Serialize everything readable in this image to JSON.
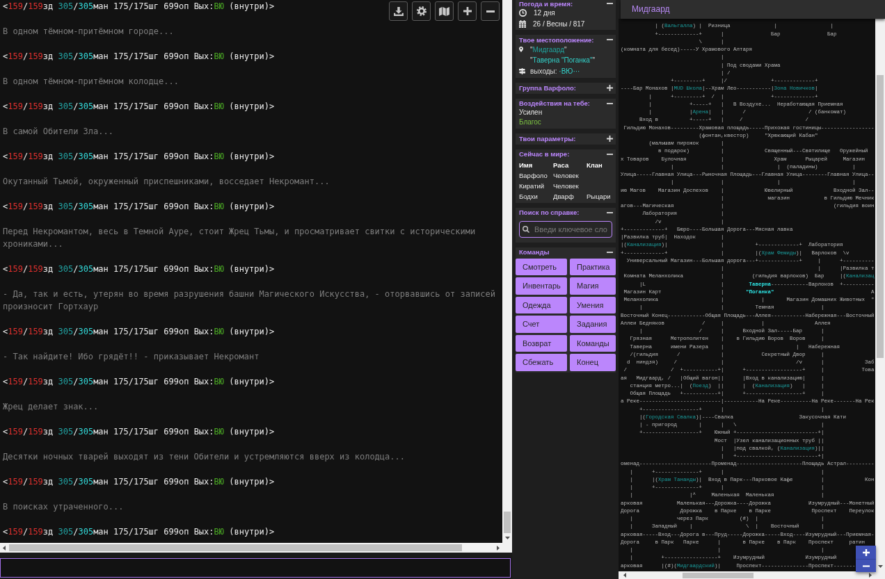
{
  "terminal": {
    "log": [
      {
        "kind": "prompt",
        "parts": [
          {
            "text": "<",
            "kind": "plain"
          },
          {
            "text": "159",
            "kind": "hp"
          },
          {
            "text": "/",
            "kind": "plain"
          },
          {
            "text": "159",
            "kind": "hp"
          },
          {
            "text": "зд ",
            "kind": "plain"
          },
          {
            "text": "305",
            "kind": "mana"
          },
          {
            "text": "/",
            "kind": "plain"
          },
          {
            "text": "305",
            "kind": "mana_max"
          },
          {
            "text": "ман 175/175шг 699оп Вых:",
            "kind": "plain"
          },
          {
            "text": "ВЮ",
            "kind": "exits"
          },
          {
            "text": " (внутри)>",
            "kind": "plain"
          }
        ]
      },
      {
        "kind": "message",
        "text": "В одном тёмном-притёмном городе..."
      },
      {
        "kind": "prompt",
        "parts": [
          {
            "text": "<",
            "kind": "plain"
          },
          {
            "text": "159",
            "kind": "hp"
          },
          {
            "text": "/",
            "kind": "plain"
          },
          {
            "text": "159",
            "kind": "hp"
          },
          {
            "text": "зд ",
            "kind": "plain"
          },
          {
            "text": "305",
            "kind": "mana"
          },
          {
            "text": "/",
            "kind": "plain"
          },
          {
            "text": "305",
            "kind": "mana_max"
          },
          {
            "text": "ман 175/175шг 699оп Вых:",
            "kind": "plain"
          },
          {
            "text": "ВЮ",
            "kind": "exits"
          },
          {
            "text": " (внутри)>",
            "kind": "plain"
          }
        ]
      },
      {
        "kind": "message",
        "text": "В одном тёмном-притёмном колодце..."
      },
      {
        "kind": "prompt",
        "parts": [
          {
            "text": "<",
            "kind": "plain"
          },
          {
            "text": "159",
            "kind": "hp"
          },
          {
            "text": "/",
            "kind": "plain"
          },
          {
            "text": "159",
            "kind": "hp"
          },
          {
            "text": "зд ",
            "kind": "plain"
          },
          {
            "text": "305",
            "kind": "mana"
          },
          {
            "text": "/",
            "kind": "plain"
          },
          {
            "text": "305",
            "kind": "mana_max"
          },
          {
            "text": "ман 175/175шг 699оп Вых:",
            "kind": "plain"
          },
          {
            "text": "ВЮ",
            "kind": "exits"
          },
          {
            "text": " (внутри)>",
            "kind": "plain"
          }
        ]
      },
      {
        "kind": "message",
        "text": "В самой Обители Зла..."
      },
      {
        "kind": "prompt",
        "parts": [
          {
            "text": "<",
            "kind": "plain"
          },
          {
            "text": "159",
            "kind": "hp"
          },
          {
            "text": "/",
            "kind": "plain"
          },
          {
            "text": "159",
            "kind": "hp"
          },
          {
            "text": "зд ",
            "kind": "plain"
          },
          {
            "text": "305",
            "kind": "mana"
          },
          {
            "text": "/",
            "kind": "plain"
          },
          {
            "text": "305",
            "kind": "mana_max"
          },
          {
            "text": "ман 175/175шг 699оп Вых:",
            "kind": "plain"
          },
          {
            "text": "ВЮ",
            "kind": "exits"
          },
          {
            "text": " (внутри)>",
            "kind": "plain"
          }
        ]
      },
      {
        "kind": "message",
        "text": "Окутанный Тьмой, окруженный приспешниками, восседает Некромант..."
      },
      {
        "kind": "prompt",
        "parts": [
          {
            "text": "<",
            "kind": "plain"
          },
          {
            "text": "159",
            "kind": "hp"
          },
          {
            "text": "/",
            "kind": "plain"
          },
          {
            "text": "159",
            "kind": "hp"
          },
          {
            "text": "зд ",
            "kind": "plain"
          },
          {
            "text": "305",
            "kind": "mana"
          },
          {
            "text": "/",
            "kind": "plain"
          },
          {
            "text": "305",
            "kind": "mana_max"
          },
          {
            "text": "ман 175/175шг 699оп Вых:",
            "kind": "plain"
          },
          {
            "text": "ВЮ",
            "kind": "exits"
          },
          {
            "text": " (внутри)>",
            "kind": "plain"
          }
        ]
      },
      {
        "kind": "message",
        "text": "Перед Некромантом, весь в Темной Ауре, стоит Жрец Тьмы, и просматривает свитки с историческими хрониками..."
      },
      {
        "kind": "prompt",
        "parts": [
          {
            "text": "<",
            "kind": "plain"
          },
          {
            "text": "159",
            "kind": "hp"
          },
          {
            "text": "/",
            "kind": "plain"
          },
          {
            "text": "159",
            "kind": "hp"
          },
          {
            "text": "зд ",
            "kind": "plain"
          },
          {
            "text": "305",
            "kind": "mana"
          },
          {
            "text": "/",
            "kind": "plain"
          },
          {
            "text": "305",
            "kind": "mana_max"
          },
          {
            "text": "ман 175/175шг 699оп Вых:",
            "kind": "plain"
          },
          {
            "text": "ВЮ",
            "kind": "exits"
          },
          {
            "text": " (внутри)>",
            "kind": "plain"
          }
        ]
      },
      {
        "kind": "message",
        "text": "- Да, так и есть, утерян во время разрушения башни Магического Искусства, - оторвавшись от записей произносит Гортхаур"
      },
      {
        "kind": "prompt",
        "parts": [
          {
            "text": "<",
            "kind": "plain"
          },
          {
            "text": "159",
            "kind": "hp"
          },
          {
            "text": "/",
            "kind": "plain"
          },
          {
            "text": "159",
            "kind": "hp"
          },
          {
            "text": "зд ",
            "kind": "plain"
          },
          {
            "text": "305",
            "kind": "mana"
          },
          {
            "text": "/",
            "kind": "plain"
          },
          {
            "text": "305",
            "kind": "mana_max"
          },
          {
            "text": "ман 175/175шг 699оп Вых:",
            "kind": "plain"
          },
          {
            "text": "ВЮ",
            "kind": "exits"
          },
          {
            "text": " (внутри)>",
            "kind": "plain"
          }
        ]
      },
      {
        "kind": "message",
        "text": "- Так найдите! Ибо грядёт!! - приказывает Некромант"
      },
      {
        "kind": "prompt",
        "parts": [
          {
            "text": "<",
            "kind": "plain"
          },
          {
            "text": "159",
            "kind": "hp"
          },
          {
            "text": "/",
            "kind": "plain"
          },
          {
            "text": "159",
            "kind": "hp"
          },
          {
            "text": "зд ",
            "kind": "plain"
          },
          {
            "text": "305",
            "kind": "mana"
          },
          {
            "text": "/",
            "kind": "plain"
          },
          {
            "text": "305",
            "kind": "mana_max"
          },
          {
            "text": "ман 175/175шг 699оп Вых:",
            "kind": "plain"
          },
          {
            "text": "ВЮ",
            "kind": "exits"
          },
          {
            "text": " (внутри)>",
            "kind": "plain"
          }
        ]
      },
      {
        "kind": "message",
        "text": "Жрец делает знак..."
      },
      {
        "kind": "prompt",
        "parts": [
          {
            "text": "<",
            "kind": "plain"
          },
          {
            "text": "159",
            "kind": "hp"
          },
          {
            "text": "/",
            "kind": "plain"
          },
          {
            "text": "159",
            "kind": "hp"
          },
          {
            "text": "зд ",
            "kind": "plain"
          },
          {
            "text": "305",
            "kind": "mana"
          },
          {
            "text": "/",
            "kind": "plain"
          },
          {
            "text": "305",
            "kind": "mana_max"
          },
          {
            "text": "ман 175/175шг 699оп Вых:",
            "kind": "plain"
          },
          {
            "text": "ВЮ",
            "kind": "exits"
          },
          {
            "text": " (внутри)>",
            "kind": "plain"
          }
        ]
      },
      {
        "kind": "message",
        "text": "Десятки ночных тварей выходят из тени Обители и устремляются вверх из колодца..."
      },
      {
        "kind": "prompt",
        "parts": [
          {
            "text": "<",
            "kind": "plain"
          },
          {
            "text": "159",
            "kind": "hp"
          },
          {
            "text": "/",
            "kind": "plain"
          },
          {
            "text": "159",
            "kind": "hp"
          },
          {
            "text": "зд ",
            "kind": "plain"
          },
          {
            "text": "305",
            "kind": "mana"
          },
          {
            "text": "/",
            "kind": "plain"
          },
          {
            "text": "305",
            "kind": "mana_max"
          },
          {
            "text": "ман 175/175шг 699оп Вых:",
            "kind": "plain"
          },
          {
            "text": "ВЮ",
            "kind": "exits"
          },
          {
            "text": " (внутри)>",
            "kind": "plain"
          }
        ]
      },
      {
        "kind": "message",
        "text": "В поисках утраченного..."
      },
      {
        "kind": "prompt",
        "parts": [
          {
            "text": "<",
            "kind": "plain"
          },
          {
            "text": "159",
            "kind": "hp"
          },
          {
            "text": "/",
            "kind": "plain"
          },
          {
            "text": "159",
            "kind": "hp"
          },
          {
            "text": "зд ",
            "kind": "plain"
          },
          {
            "text": "305",
            "kind": "mana"
          },
          {
            "text": "/",
            "kind": "plain"
          },
          {
            "text": "305",
            "kind": "mana_max"
          },
          {
            "text": "ман 175/175шг 699оп Вых:",
            "kind": "plain"
          },
          {
            "text": "ВЮ",
            "kind": "exits"
          },
          {
            "text": " (внутри)>",
            "kind": "plain"
          }
        ]
      }
    ]
  },
  "sidebar": {
    "panels": [
      {
        "kind": "weather",
        "title": "Погода и время:",
        "expanded": true,
        "time": "12 дня",
        "date": "26 / Весны / 817"
      },
      {
        "kind": "location",
        "title": "Твое местоположение:",
        "expanded": true,
        "lines": [
          {
            "kind": "zone",
            "parts": [
              {
                "text": "\"",
                "kind": "plain"
              },
              {
                "text": "Мидгаард",
                "kind": "zone"
              },
              {
                "text": "\"",
                "kind": "plain"
              }
            ]
          },
          {
            "kind": "room",
            "parts": [
              {
                "text": "\"",
                "kind": "plain"
              },
              {
                "text": "Таверна \"Поганка\"",
                "kind": "room"
              },
              {
                "text": "\"",
                "kind": "plain"
              }
            ]
          },
          {
            "kind": "exits",
            "parts": [
              {
                "text": "выходы: ",
                "kind": "plain"
              },
              {
                "text": "·ВЮ···",
                "kind": "room"
              }
            ]
          }
        ]
      },
      {
        "kind": "group",
        "title": "Группа Варфоло:",
        "expanded": false
      },
      {
        "kind": "affects",
        "title": "Воздействия на тебе:",
        "expanded": true,
        "items": [
          {
            "text": "Усилен",
            "kind": "default"
          },
          {
            "text": "Благос",
            "kind": "highlight"
          }
        ]
      },
      {
        "kind": "stats",
        "title": "Твои параметры:",
        "expanded": false
      },
      {
        "kind": "online",
        "title": "Сейчас в мире:",
        "expanded": true,
        "columns": [
          "Имя",
          "Раса",
          "Клан"
        ],
        "rows": [
          [
            "Варфоло",
            "Человек"
          ],
          [
            "Киратий",
            "Человек"
          ],
          [
            "Бодхи",
            "Дварф",
            "Рыцари"
          ]
        ]
      },
      {
        "kind": "help",
        "title": "Поиск по справке:",
        "expanded": true,
        "search": {
          "placeholder": "Введи ключевое сло"
        }
      },
      {
        "kind": "commands",
        "title": "Команды",
        "expanded": true,
        "buttons": [
          "Смотреть",
          "Практика",
          "Инвентарь",
          "Магия",
          "Одежда",
          "Умения",
          "Счет",
          "Задания",
          "Возврат",
          "Команды",
          "Сбежать",
          "Конец"
        ]
      }
    ]
  },
  "map": {
    "title": "Мидгаард",
    "lines": [
      [
        {
          "kind": "plain",
          "text": "           | ("
        },
        {
          "kind": "zone",
          "text": "Вальгалла"
        },
        {
          "kind": "plain",
          "text": ") |  Ризница              |                 |"
        }
      ],
      [
        {
          "kind": "plain",
          "text": "           +-------------+      |               Бар               Бар"
        }
      ],
      [
        {
          "kind": "plain",
          "text": "                         \\      |"
        }
      ],
      [
        {
          "kind": "plain",
          "text": "(комната для бесед)-----У Храмового Алтаря"
        }
      ],
      [
        {
          "kind": "plain",
          "text": "                                |"
        }
      ],
      [
        {
          "kind": "plain",
          "text": "                                | Под сводами Храма"
        }
      ],
      [
        {
          "kind": "plain",
          "text": "                                | /"
        }
      ],
      [
        {
          "kind": "plain",
          "text": "                +---------+     |/              +-------------+"
        }
      ],
      [
        {
          "kind": "plain",
          "text": "----Бар Монахов |"
        },
        {
          "kind": "zone",
          "text": "MUD Школа"
        },
        {
          "kind": "plain",
          "text": "|--Храм Лео-----------|"
        },
        {
          "kind": "zone",
          "text": "Зона Новичков"
        },
        {
          "kind": "plain",
          "text": "|"
        }
      ],
      [
        {
          "kind": "plain",
          "text": "         |      +---------+  /  |               +-------------+"
        }
      ],
      [
        {
          "kind": "plain",
          "text": "         |            +-----+   |   В Воздухе...  Неработающая Приемная"
        }
      ],
      [
        {
          "kind": "plain",
          "text": "         |            |"
        },
        {
          "kind": "zone",
          "text": "Арена"
        },
        {
          "kind": "plain",
          "text": "|   |      /                    / (банкомат)"
        }
      ],
      [
        {
          "kind": "plain",
          "text": "      Вход в          +-----+   |     /                    /"
        }
      ],
      [
        {
          "kind": "plain",
          "text": " Гильдию Монахов---------Храмовая площадь-----Прихожая гостиницы-----------------"
        }
      ],
      [
        {
          "kind": "plain",
          "text": "                         (фонтан,квестор)     \"Хрюкающий Кабан\""
        }
      ],
      [
        {
          "kind": "plain",
          "text": "         (малышам пирожок       |"
        }
      ],
      [
        {
          "kind": "plain",
          "text": "            в подарок)          |             Священный---Святилище   Оружейный"
        }
      ],
      [
        {
          "kind": "plain",
          "text": "х Товаров    Булочная           |                Храм      Рыцарей     Магазин"
        }
      ],
      [
        {
          "kind": "plain",
          "text": "                |               |                 |  (паладины)           |"
        }
      ],
      [
        {
          "kind": "plain",
          "text": "Улица-----Главная Улица---Рыночная Площадь---Главная Улица--------Главная Улица--"
        }
      ],
      [
        {
          "kind": "plain",
          "text": "                |               |                 |                       |"
        }
      ],
      [
        {
          "kind": "plain",
          "text": "ию Магов    Магазин Доспехов    |             Ювелирный             Входной Зал--"
        }
      ],
      [
        {
          "kind": "plain",
          "text": "                                |              магазин           в Гильдию Мечник"
        }
      ],
      [
        {
          "kind": "plain",
          "text": "агов---Магическая               |                                   (гильдия воин"
        }
      ],
      [
        {
          "kind": "plain",
          "text": "       Лаборатория              |"
        }
      ],
      [
        {
          "kind": "plain",
          "text": "           /v                   |"
        }
      ],
      [
        {
          "kind": "plain",
          "text": "+-------------+   Бюро----Большая Дорога---Мясная лавка"
        }
      ],
      [
        {
          "kind": "plain",
          "text": "|Развилка труб|  Находок        |"
        }
      ],
      [
        {
          "kind": "plain",
          "text": "|("
        },
        {
          "kind": "zone",
          "text": "Канализация"
        },
        {
          "kind": "plain",
          "text": ")|                 |          +-------------+  Лаборатория"
        }
      ],
      [
        {
          "kind": "plain",
          "text": "+-------------+                 |          |("
        },
        {
          "kind": "zone",
          "text": "Храм Фемиды"
        },
        {
          "kind": "plain",
          "text": ")|   Варлоков  \\v"
        }
      ],
      [
        {
          "kind": "plain",
          "text": "  Универсальный Магазин---Большая дорога---+-------------+     |      +----------"
        }
      ],
      [
        {
          "kind": "plain",
          "text": "                                |                              |      |Развилка т"
        }
      ],
      [
        {
          "kind": "plain",
          "text": " Комната Меланхолика            |         (гильдия варлоков)  Бар     |("
        },
        {
          "kind": "zone",
          "text": "Канализац"
        }
      ],
      [
        {
          "kind": "plain",
          "text": "      |L                        |        "
        },
        {
          "kind": "here",
          "text": "Таверна"
        },
        {
          "kind": "plain",
          "text": "------------Варлоков  +----------"
        }
      ],
      [
        {
          "kind": "plain",
          "text": " Магазин Карт                   |       "
        },
        {
          "kind": "here",
          "text": "\"Поганка\""
        },
        {
          "kind": "plain",
          "text": "                               А"
        }
      ],
      [
        {
          "kind": "plain",
          "text": " Меланхолика                    |            |       Магазин Домашних Животных  \""
        }
      ],
      [
        {
          "kind": "plain",
          "text": "      |                         |          Темная               |"
        }
      ],
      [
        {
          "kind": "plain",
          "text": "Восточный Конец------------Общая Площадь---Аллея-----------Набережная---Восточный"
        }
      ],
      [
        {
          "kind": "plain",
          "text": "Аллеи Бедняков            /     |            |                Аллея"
        }
      ],
      [
        {
          "kind": "plain",
          "text": "      |                  /      |      Входной Зал-----Бар      |"
        }
      ],
      [
        {
          "kind": "plain",
          "text": "   Грязная      Метрополитен    |    в Гильдию Воров  Воров     |"
        }
      ],
      [
        {
          "kind": "plain",
          "text": "   Таверна      имени Разера    |                       |   Набережная"
        }
      ],
      [
        {
          "kind": "plain",
          "text": "   /(гильдия      /             |            Секретный Двор     |"
        }
      ],
      [
        {
          "kind": "plain",
          "text": "  d  ниндзя)     /              |                       /v      |             Заб"
        }
      ],
      [
        {
          "kind": "plain",
          "text": " /              /  +-----------+|      +------------------+     |            Това"
        }
      ],
      [
        {
          "kind": "plain",
          "text": "ая   Мидгаард, /   |Общий вагон||      |Вход в канализацию|     |"
        }
      ],
      [
        {
          "kind": "plain",
          "text": "   станция метро...|  ("
        },
        {
          "kind": "zone",
          "text": "Поезд"
        },
        {
          "kind": "plain",
          "text": ")  ||      |  ("
        },
        {
          "kind": "zone",
          "text": "Канализация"
        },
        {
          "kind": "plain",
          "text": ")   |     |"
        }
      ],
      [
        {
          "kind": "plain",
          "text": "   Общая Площадь   +-----------+|      +------------------+     |"
        }
      ],
      [
        {
          "kind": "plain",
          "text": "а Реке--------------------------|-----------На Реке----------На Реке-------На Рек"
        }
      ],
      [
        {
          "kind": "plain",
          "text": "      +------------------+      |                               |"
        }
      ],
      [
        {
          "kind": "plain",
          "text": "      |("
        },
        {
          "kind": "zone",
          "text": "Городская Свалка"
        },
        {
          "kind": "plain",
          "text": ")|----Свалка                     Закусочная Кати"
        }
      ],
      [
        {
          "kind": "plain",
          "text": "      | - пригород       |      |   \\                           |"
        }
      ],
      [
        {
          "kind": "plain",
          "text": "      +------------------+    Южный +--------------------------+|"
        }
      ],
      [
        {
          "kind": "plain",
          "text": "                              Мост  |Узел канализационных труб ||"
        }
      ],
      [
        {
          "kind": "plain",
          "text": "                                |   |под свалкой, ("
        },
        {
          "kind": "zone",
          "text": "Канализация"
        },
        {
          "kind": "plain",
          "text": ")||"
        }
      ],
      [
        {
          "kind": "plain",
          "text": "                                |   +--------------------------+|"
        }
      ],
      [
        {
          "kind": "plain",
          "text": "оменад-----------------------Променад---------------------Площадь Астрал---------"
        }
      ],
      [
        {
          "kind": "plain",
          "text": "   |      +--------------+      |                               |"
        }
      ],
      [
        {
          "kind": "plain",
          "text": "   |      |("
        },
        {
          "kind": "zone",
          "text": "Храм Тананды"
        },
        {
          "kind": "plain",
          "text": ")|  Вход в Парк---Парковое Кафе         |             Кон"
        }
      ],
      [
        {
          "kind": "plain",
          "text": "   |      +--------------+      |                               |"
        }
      ],
      [
        {
          "kind": "plain",
          "text": "   |                  |^     Маленькая  Маленькая               |"
        }
      ],
      [
        {
          "kind": "plain",
          "text": "арковая           Маленькая---Дорожка----Дорожка            Изумрудный---Монетный"
        }
      ],
      [
        {
          "kind": "plain",
          "text": "Дорога             Дорожка    в Парке    в Парке             Проспект    Переулок"
        }
      ],
      [
        {
          "kind": "plain",
          "text": "   |              через Парк          (#)  |                    |"
        }
      ],
      [
        {
          "kind": "plain",
          "text": "   |      Западный    |                 \\  |    Восточный       |"
        }
      ],
      [
        {
          "kind": "plain",
          "text": "арковая-----Вход---Дорога в---Пруд-----Дорожка-----Вход----Изумрудный---Приемная-"
        }
      ],
      [
        {
          "kind": "plain",
          "text": "Дорога     в Парк   Парке      |       в Парке    в Парк    Проспект     ратин"
        }
      ],
      [
        {
          "kind": "plain",
          "text": "   |                           |                                |"
        }
      ],
      [
        {
          "kind": "plain",
          "text": "   |         +-----------------+    Изумрудный             Изумрудный"
        }
      ],
      [
        {
          "kind": "plain",
          "text": "арковая      |(#)("
        },
        {
          "kind": "zone",
          "text": "Мидгаардский"
        },
        {
          "kind": "plain",
          "text": ")|     Проспект---------------Проспект-------"
        }
      ]
    ]
  }
}
